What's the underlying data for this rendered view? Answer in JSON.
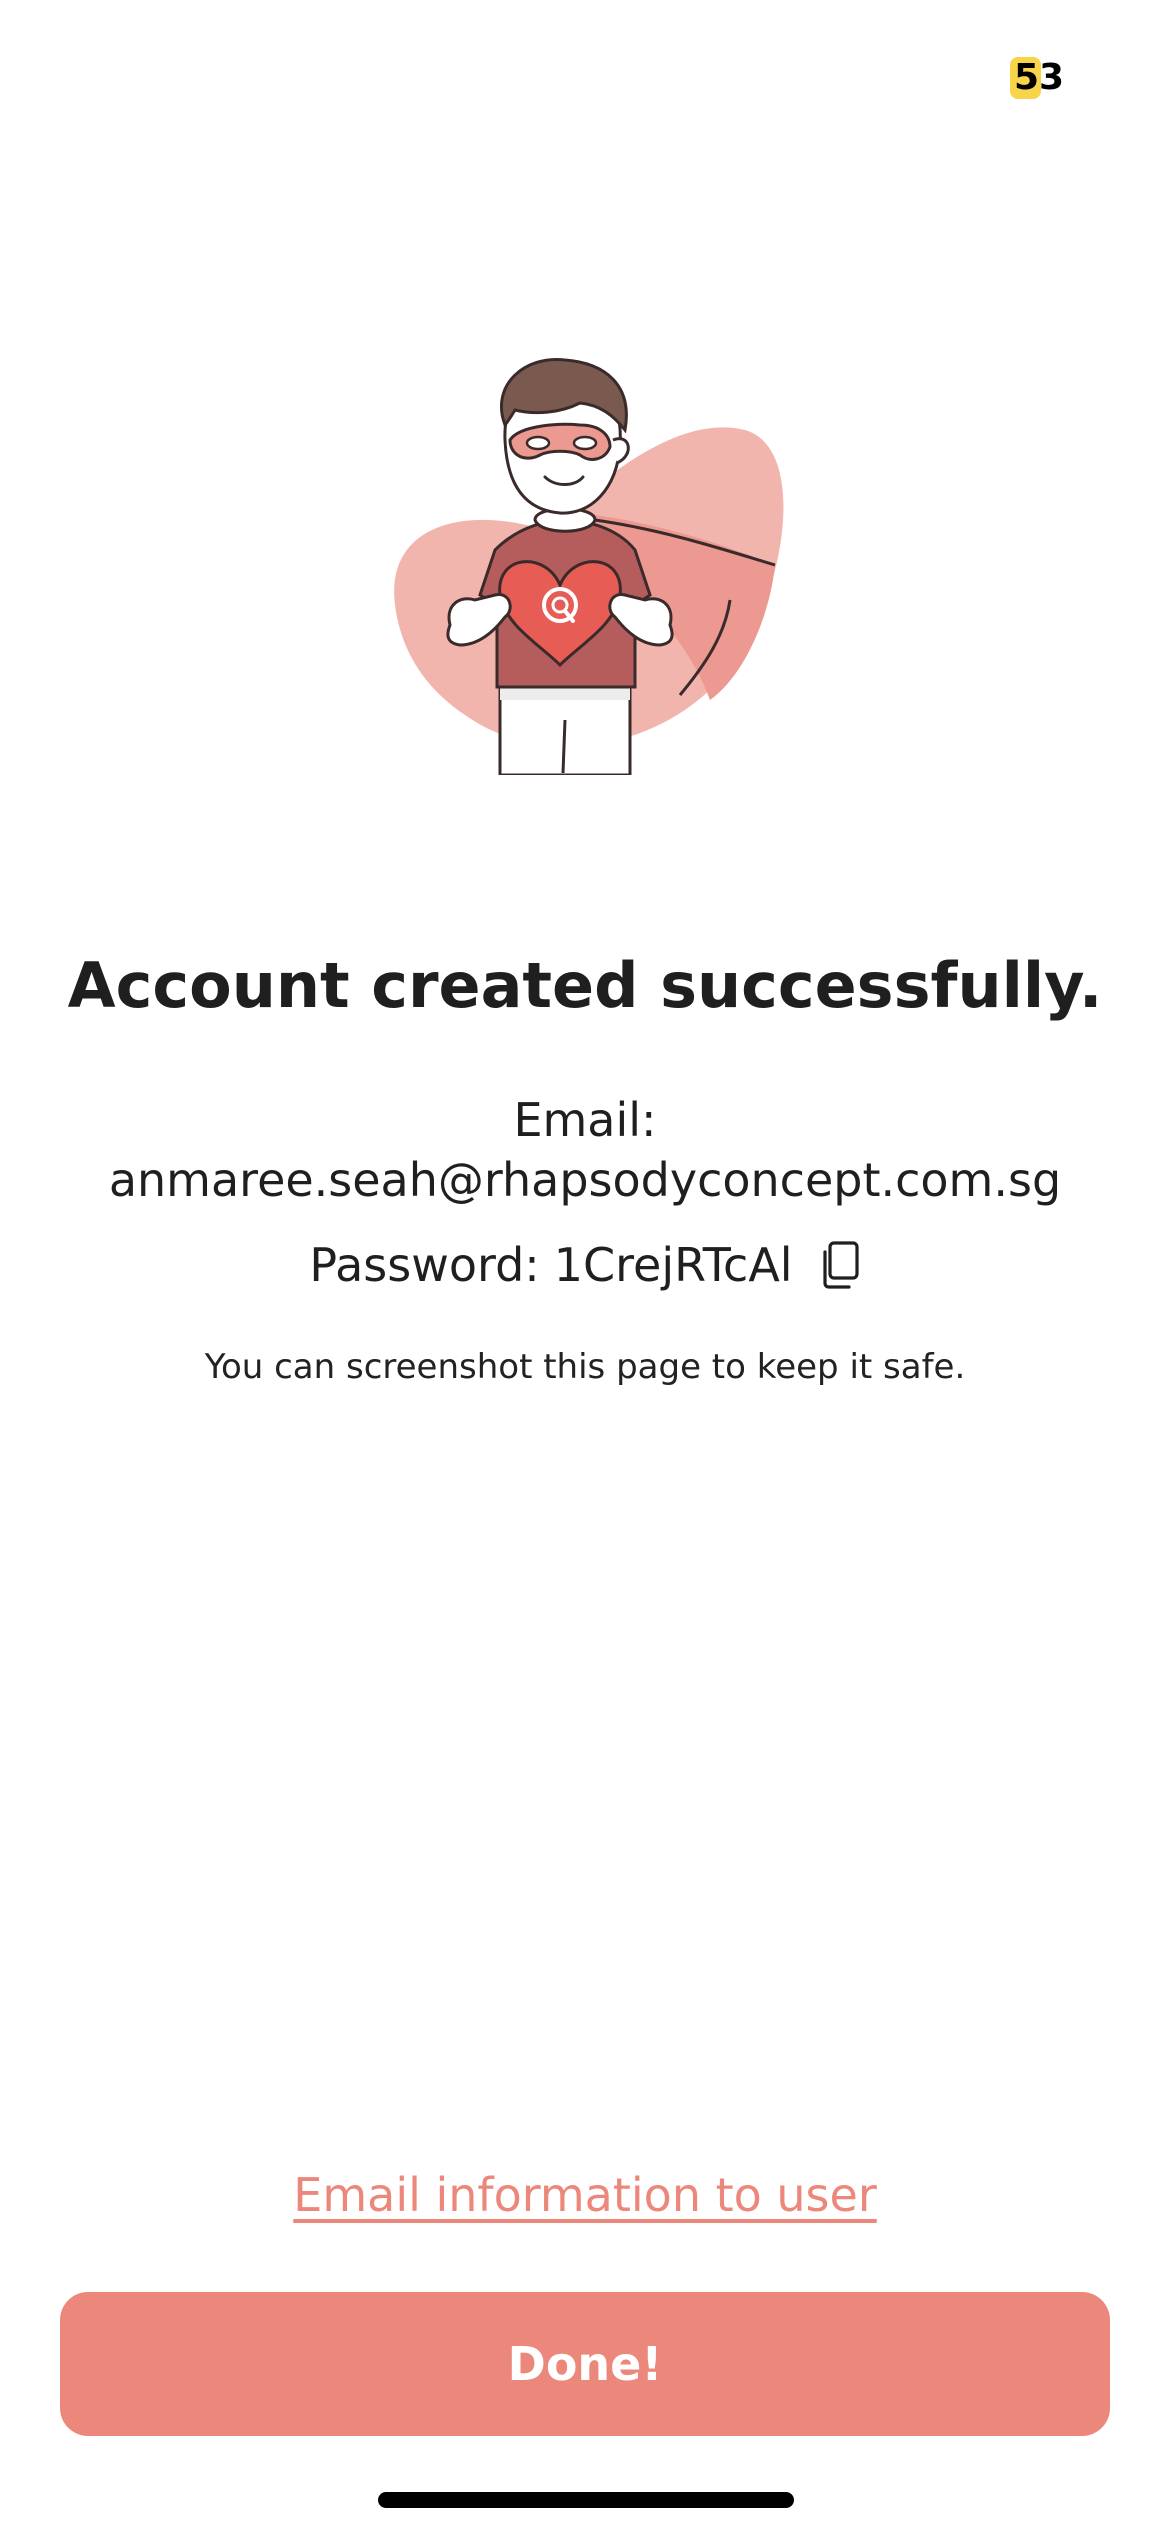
{
  "status_bar": {
    "battery_level": "53",
    "battery_fraction": 0.53,
    "battery_color": "#f7d44a"
  },
  "illustration": {
    "icon": "superhero-heart-illustration"
  },
  "main": {
    "title": "Account created successfully.",
    "email_label": "Email:",
    "email_value": "anmaree.seah@rhapsodyconcept.com.sg",
    "password_label": "Password:",
    "password_value": "1CrejRTcAl",
    "copy_icon": "copy-icon",
    "hint": "You can screenshot this page to keep it safe."
  },
  "actions": {
    "email_link_label": "Email information to user",
    "done_label": "Done!",
    "accent_color": "#ec877b"
  }
}
